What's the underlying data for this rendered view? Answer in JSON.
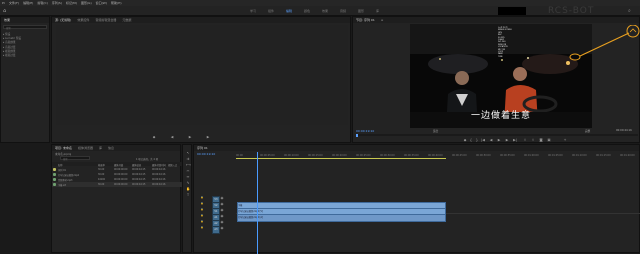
{
  "menu": [
    "Pr",
    "文件(F)",
    "编辑(E)",
    "剪辑(C)",
    "序列(S)",
    "标记(M)",
    "图形(G)",
    "窗口(W)",
    "帮助(H)"
  ],
  "workspaces": [
    {
      "label": "学习",
      "active": false
    },
    {
      "label": "组件",
      "active": false
    },
    {
      "label": "编辑",
      "active": true
    },
    {
      "label": "颜色",
      "active": false
    },
    {
      "label": "效果",
      "active": false
    },
    {
      "label": "音频",
      "active": false
    },
    {
      "label": "图形",
      "active": false
    },
    {
      "label": "库",
      "active": false
    }
  ],
  "watermark": "RCS-BOT",
  "source_panel": {
    "tabs": [
      {
        "label": "源: (无剪辑)",
        "active": true
      },
      {
        "label": "效果控件",
        "active": false
      },
      {
        "label": "音频剪辑混合器",
        "active": false
      },
      {
        "label": "元数据",
        "active": false
      }
    ]
  },
  "left_panel": {
    "tabs": [
      {
        "label": "效果",
        "active": true
      }
    ],
    "search_placeholder": "搜索",
    "items": [
      "预设",
      "Lumetri 预设",
      "音频效果",
      "音频过渡",
      "视频效果",
      "视频过渡"
    ]
  },
  "program": {
    "title": "节目: 序列 01",
    "subtitle": "一边做着生意",
    "timecode": "00:00:19:10",
    "zoom": "适合",
    "quality": "完整",
    "duration": "00:00:44:16",
    "overlay_lines": [
      "人 在 车 内",
      "SPEED 0 KM/H",
      "GPS",
      "REC",
      "30 FPS",
      "1080P",
      "ISO 200",
      "WDR ON",
      "LOCATION",
      "MIC ON",
      "LOOP",
      "PARK",
      "TIME"
    ]
  },
  "project": {
    "tabs": [
      {
        "label": "项目: 未命名",
        "active": true
      },
      {
        "label": "媒体浏览器",
        "active": false
      },
      {
        "label": "库",
        "active": false
      },
      {
        "label": "信息",
        "active": false
      }
    ],
    "filename": "未命名.prproj",
    "search_placeholder": "搜索",
    "count": "1 项已选择，共 4 项",
    "columns": [
      "名称",
      "帧速率",
      "媒体开始",
      "媒体结束",
      "媒体持续时间",
      "视频入点"
    ],
    "rows": [
      {
        "name": "序列 01",
        "fps": "30.00",
        "start": "00:00:00:00",
        "end": "00:00:44:15",
        "dur": "00:00:44:16",
        "color": "#c0c060"
      },
      {
        "name": "行车记录仪视频.mp4",
        "fps": "30.00",
        "start": "00:00:00:00",
        "end": "00:00:44:15",
        "dur": "00:00:44:16",
        "color": "#6fa06f"
      },
      {
        "name": "音频素材.mp3",
        "fps": "44100",
        "start": "00:00:00:00",
        "end": "00:00:44:15",
        "dur": "00:00:44:16",
        "color": "#6fa06f"
      },
      {
        "name": "字幕.srt",
        "fps": "30.00",
        "start": "00:00:00:00",
        "end": "00:00:44:15",
        "dur": "00:00:44:16",
        "color": "#6fa06f"
      }
    ]
  },
  "timeline": {
    "tab": "序列 01",
    "timecode": "00:00:19:10",
    "ruler": [
      "00:00",
      "00:00:05:00",
      "00:00:10:00",
      "00:00:15:00",
      "00:00:20:00",
      "00:00:25:00",
      "00:00:30:00",
      "00:00:35:00",
      "00:00:40:00",
      "00:00:45:00",
      "00:00:50:00",
      "00:00:55:00",
      "00:01:00:00",
      "00:01:05:00",
      "00:01:10:00",
      "00:01:15:00",
      "00:01:20:00"
    ],
    "tracks": [
      "V3",
      "V2",
      "V1",
      "A1",
      "A2",
      "A3"
    ],
    "clips": {
      "v2": "字幕",
      "v1": "行车记录仪视频.mp4 [V]",
      "a1": "行车记录仪视频.mp4 [A]"
    }
  },
  "colors": {
    "accent": "#5aa0ff",
    "clip": "#7aa6d6",
    "playhead": "#4a9bff"
  }
}
